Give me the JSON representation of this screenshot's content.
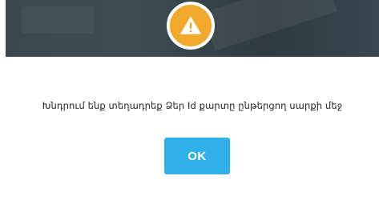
{
  "dialog": {
    "icon": "warning-icon",
    "message": "Խնդրում ենք տեղադրեք Ձեր Id քարտը ընթերցող սարքի մեջ",
    "ok_label": "OK"
  },
  "colors": {
    "warning_badge": "#f0a92c",
    "ok_button": "#2fb0ea",
    "backdrop": "#3a474f"
  }
}
